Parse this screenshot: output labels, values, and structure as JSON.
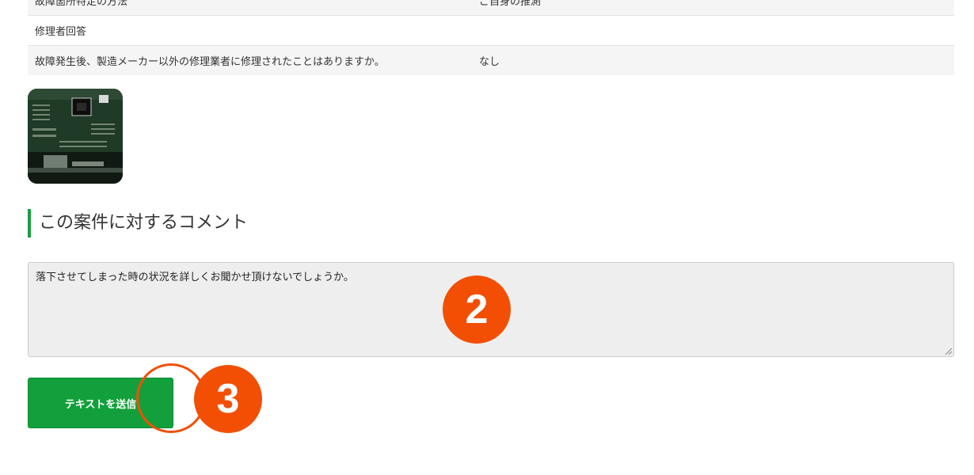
{
  "details_table": {
    "rows": [
      {
        "label": "故障箇所特定の方法",
        "value": "ご自身の推測",
        "shaded": true
      },
      {
        "label": "修理者回答",
        "value": "",
        "shaded": false
      },
      {
        "label": "故障発生後、製造メーカー以外の修理業者に修理されたことはありますか。",
        "value": "なし",
        "shaded": true
      }
    ]
  },
  "comment_section": {
    "title": "この案件に対するコメント",
    "comment_text": "落下させてしまった時の状況を詳しくお聞かせ頂けないでしょうか。",
    "send_button_label": "テキストを送信"
  },
  "annotations": {
    "badge_2": "2",
    "badge_3": "3"
  },
  "colors": {
    "accent_green": "#13a03c",
    "annotation_orange": "#f24f05"
  },
  "icons": [
    "circuit-board-photo",
    "resize-grip-icon"
  ]
}
